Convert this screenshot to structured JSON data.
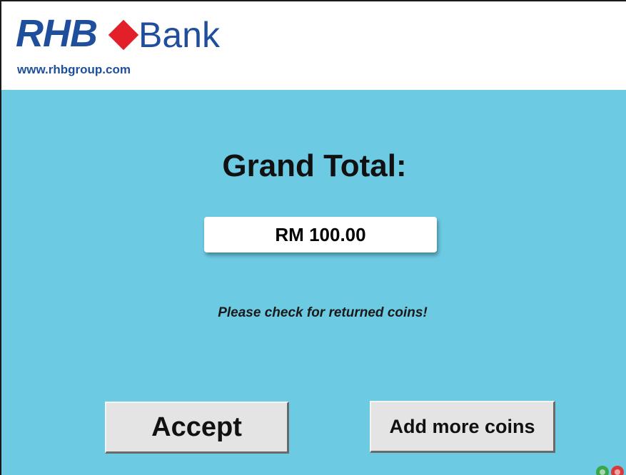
{
  "header": {
    "logo_rhb": "RHB",
    "logo_bank": "Bank",
    "logo_url": "www.rhbgroup.com"
  },
  "main": {
    "title": "Grand Total:",
    "amount": "RM 100.00",
    "message": "Please check for returned coins!"
  },
  "buttons": {
    "accept_label": "Accept",
    "add_more_label": "Add more coins"
  },
  "colors": {
    "background": "#6ccbe3",
    "header_background": "#ffffff",
    "brand_blue": "#1f4f9c",
    "brand_red": "#e3202a",
    "button_face": "#e4e4e4"
  },
  "icons": {
    "logo_mark": "red-diamond-icon",
    "corner_indicator_left": "green-circle-icon",
    "corner_indicator_right": "red-circle-icon"
  }
}
